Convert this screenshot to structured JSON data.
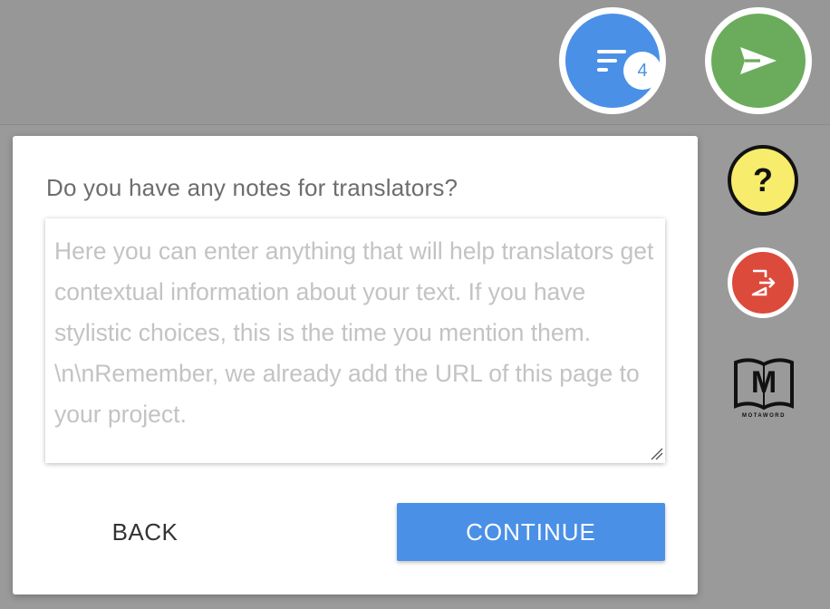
{
  "dialog": {
    "question": "Do you have any notes for translators?",
    "notes_placeholder": "Here you can enter anything that will help translators get contextual information about your text. If you have stylistic choices, this is the time you mention them. \\n\\nRemember, we already add the URL of this page to your project.",
    "notes_value": "",
    "back_label": "BACK",
    "continue_label": "CONTINUE"
  },
  "sidebar": {
    "filter_button": {
      "icon": "filter-list-icon",
      "badge_count": "4"
    },
    "send_button": {
      "icon": "send-icon"
    },
    "help_button": {
      "icon": "help-icon",
      "glyph": "?"
    },
    "logout_button": {
      "icon": "logout-icon"
    },
    "logo": {
      "icon": "motaword-logo",
      "letter": "M",
      "caption": "MOTAWORD"
    }
  },
  "colors": {
    "accent_blue": "#4a90e6",
    "send_green": "#6aac5b",
    "help_yellow": "#f7ec6b",
    "logout_red": "#dc4a3b",
    "overlay_gray": "#9a9a9a"
  }
}
